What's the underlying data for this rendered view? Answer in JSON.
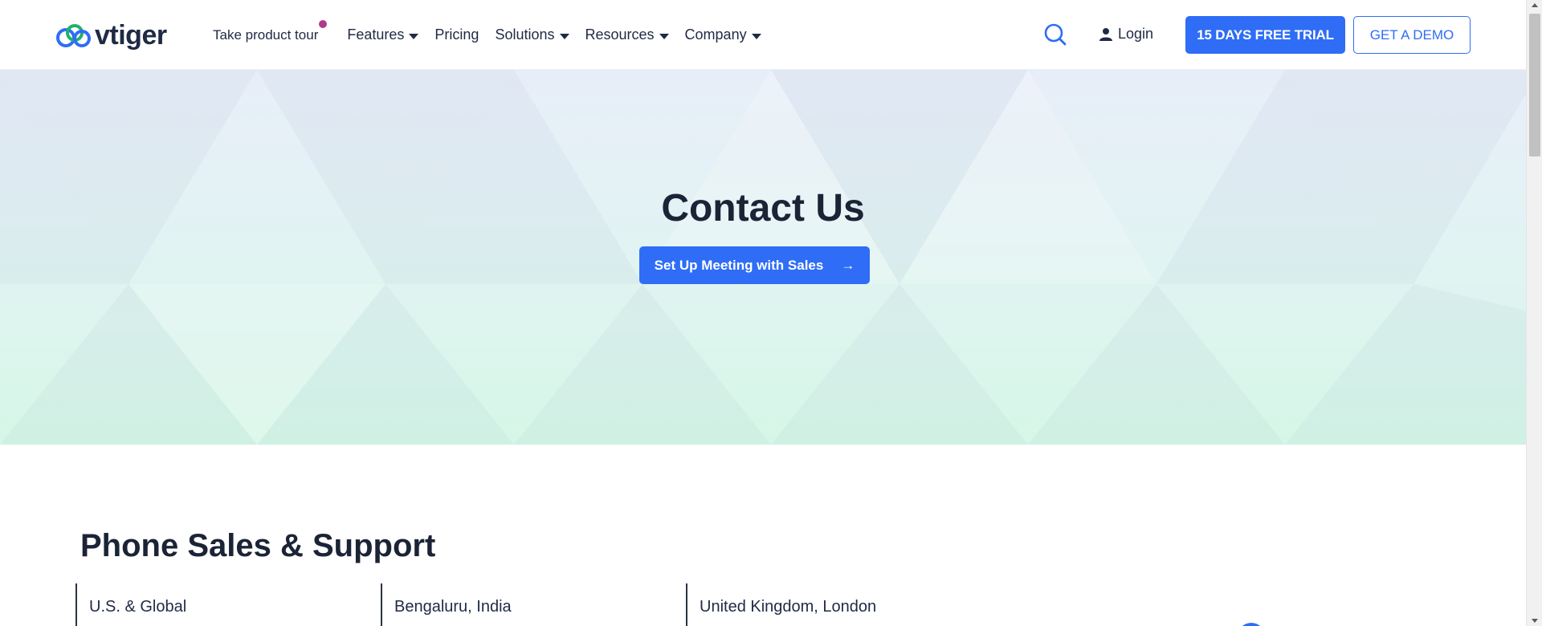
{
  "brand": {
    "name": "vtiger"
  },
  "nav": {
    "tour": "Take product tour",
    "items": [
      {
        "label": "Features",
        "dropdown": true
      },
      {
        "label": "Pricing",
        "dropdown": false
      },
      {
        "label": "Solutions",
        "dropdown": true
      },
      {
        "label": "Resources",
        "dropdown": true
      },
      {
        "label": "Company",
        "dropdown": true
      }
    ]
  },
  "header": {
    "search_icon": "search-icon",
    "login_label": "Login",
    "trial_label": "15 DAYS FREE TRIAL",
    "demo_label": "GET A DEMO"
  },
  "hero": {
    "title": "Contact Us",
    "meeting_label": "Set Up Meeting with Sales",
    "meeting_arrow": "→"
  },
  "phone_section": {
    "title": "Phone Sales & Support",
    "offices": [
      "U.S. & Global",
      "Bengaluru, India",
      "United Kingdom, London"
    ]
  },
  "colors": {
    "accent": "#2f6df6",
    "text": "#1c2434",
    "tour_dot": "#b03a8a",
    "hero_top": "#e8eef9",
    "hero_bottom": "#d6f7e7"
  }
}
